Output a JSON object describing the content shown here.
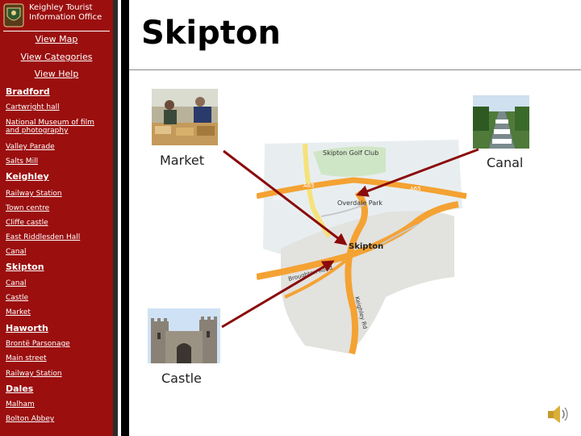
{
  "office": {
    "line1": "Keighley Tourist",
    "line2": "Information Office"
  },
  "topnav": {
    "map": "View Map",
    "categories": "View Categories",
    "help": "View Help"
  },
  "page_title": "Skipton",
  "sections": [
    {
      "heading": "Bradford",
      "items": [
        "Cartwright hall",
        "National Museum of film and photography",
        "Valley Parade",
        "Salts Mill"
      ]
    },
    {
      "heading": "Keighley",
      "items": [
        "Railway Station",
        "Town centre",
        "Cliffe castle",
        "East Riddlesden Hall",
        "Canal"
      ]
    },
    {
      "heading": "Skipton",
      "items": [
        "Canal",
        "Castle",
        "Market"
      ]
    },
    {
      "heading": "Haworth",
      "items": [
        "Brontë Parsonage",
        "Main street",
        "Railway Station"
      ]
    },
    {
      "heading": "Dales",
      "items": [
        "Malham",
        "Bolton Abbey"
      ]
    }
  ],
  "captions": {
    "market": "Market",
    "canal": "Canal",
    "castle": "Castle"
  },
  "map_labels": {
    "golf": "Skipton Golf Club",
    "overdale": "Overdale Park",
    "skipton": "Skipton",
    "a65": "A65",
    "keighley_road": "Keighley Rd",
    "broughton_road": "Broughton Road"
  },
  "colors": {
    "sidebar": "#9b0f0f",
    "arrow": "#8b0a0a",
    "road_orange": "#f4a233",
    "road_yellow": "#f6e27a"
  }
}
